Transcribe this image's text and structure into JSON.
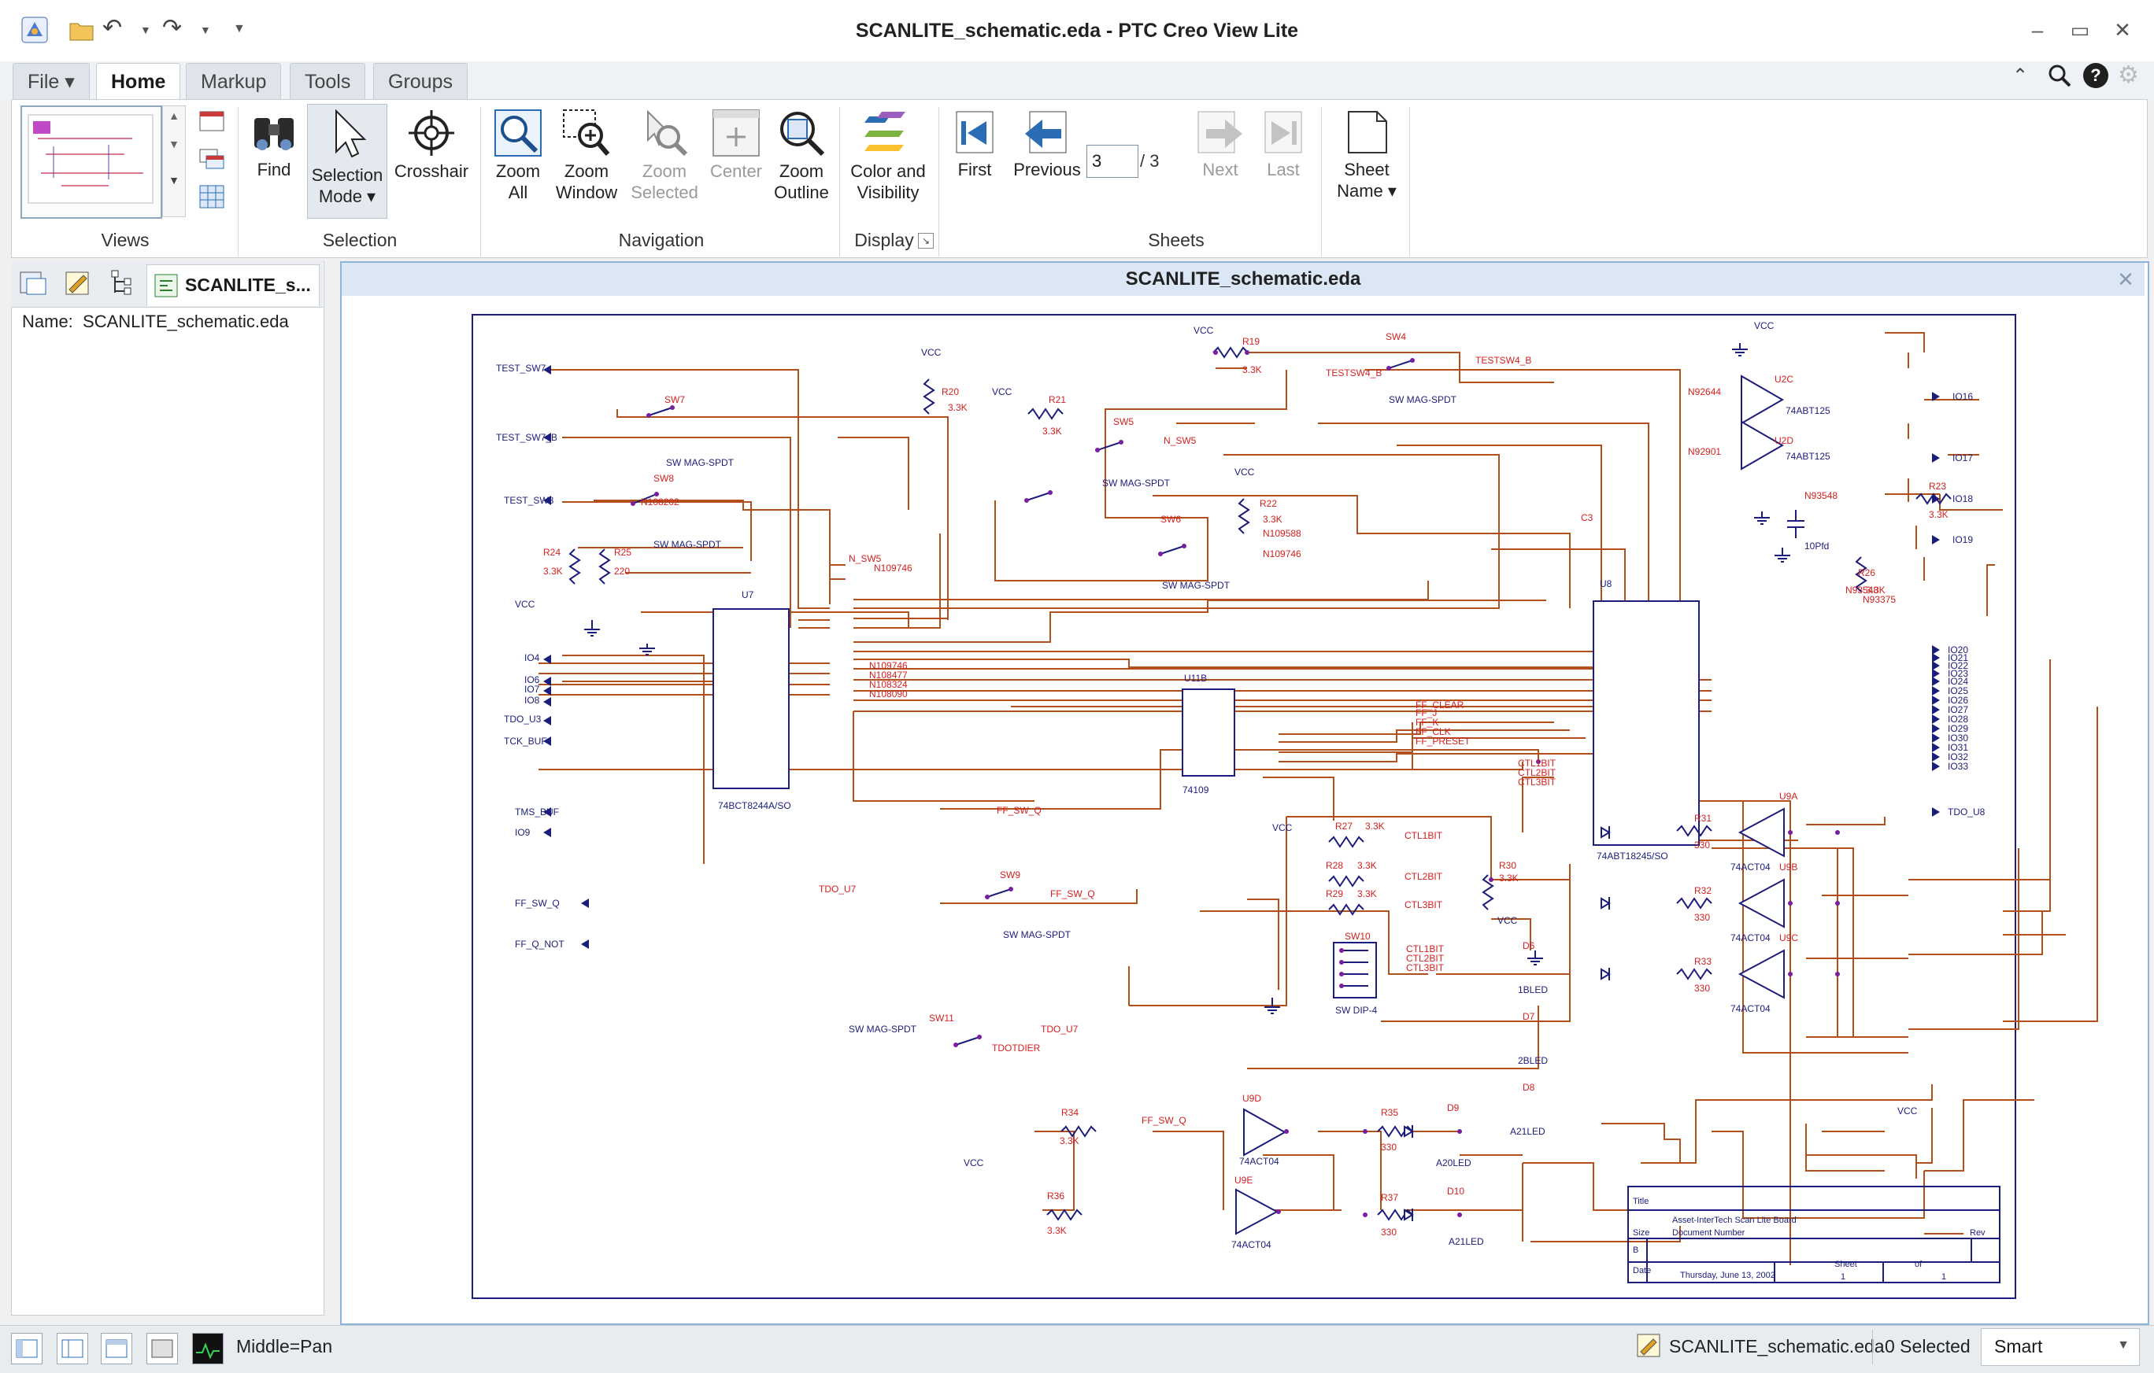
{
  "window": {
    "title": "SCANLITE_schematic.eda - PTC Creo View Lite"
  },
  "tabs": [
    "File",
    "Home",
    "Markup",
    "Tools",
    "Groups"
  ],
  "ribbon": {
    "views": {
      "label": "Views"
    },
    "selection": {
      "label": "Selection",
      "find": "Find",
      "selection_mode": [
        "Selection",
        "Mode"
      ],
      "crosshair": "Crosshair"
    },
    "navigation": {
      "label": "Navigation",
      "zoom_all": [
        "Zoom",
        "All"
      ],
      "zoom_window": [
        "Zoom",
        "Window"
      ],
      "zoom_selected": [
        "Zoom",
        "Selected"
      ],
      "center": "Center",
      "zoom_outline": [
        "Zoom",
        "Outline"
      ]
    },
    "display": {
      "label": "Display",
      "color_visibility": [
        "Color and",
        "Visibility"
      ]
    },
    "sheets": {
      "label": "Sheets",
      "first": "First",
      "previous": "Previous",
      "page_value": "3",
      "page_total": "/ 3",
      "next": "Next",
      "last": "Last",
      "sheet_name": [
        "Sheet",
        "Name"
      ]
    }
  },
  "left_panel": {
    "tab_label": "SCANLITE_s...",
    "name_label": "Name:",
    "name_value": "SCANLITE_schematic.eda"
  },
  "viewer": {
    "title": "SCANLITE_schematic.eda",
    "schematic": {
      "title_block": {
        "title_label": "Title",
        "title_value": "Asset-InterTech Scan Lite Board",
        "doc_number_label": "Document Number",
        "rev_label": "Rev",
        "size_label": "Size",
        "size_value": "B",
        "date_label": "Date",
        "date_value": "Thursday, June 13, 2002",
        "sheet_label": "Sheet",
        "sheet_value": "1",
        "of_label": "of",
        "of_value": "1"
      },
      "components": [
        {
          "ref": "U7",
          "type": "74BCT8244A/SO"
        },
        {
          "ref": "U8",
          "type": "74ABT18245/SO"
        },
        {
          "ref": "U11B",
          "type": "74109"
        },
        {
          "ref": "U2C",
          "type": "74ABT125"
        },
        {
          "ref": "U2D",
          "type": "74ABT125"
        },
        {
          "ref": "U9A",
          "type": "74ACT04"
        },
        {
          "ref": "U9B",
          "type": "74ACT04"
        },
        {
          "ref": "U9C",
          "type": "74ACT04"
        },
        {
          "ref": "U9D",
          "type": "74ACT04"
        },
        {
          "ref": "U9E",
          "type": "74ACT04"
        },
        {
          "ref": "SW4",
          "type": "SW MAG-SPDT"
        },
        {
          "ref": "SW5",
          "type": "SW MAG-SPDT"
        },
        {
          "ref": "SW6",
          "type": "SW MAG-SPDT"
        },
        {
          "ref": "SW7",
          "type": "SW MAG-SPDT"
        },
        {
          "ref": "SW8",
          "type": "SW MAG-SPDT"
        },
        {
          "ref": "SW9",
          "type": "SW MAG-SPDT"
        },
        {
          "ref": "SW10",
          "type": "SW DIP-4"
        },
        {
          "ref": "SW11",
          "type": "SW MAG-SPDT"
        },
        {
          "ref": "D6",
          "type": "1BLED"
        },
        {
          "ref": "D7",
          "type": "2BLED"
        },
        {
          "ref": "D8",
          "type": "A21LED"
        },
        {
          "ref": "D9",
          "type": "A20LED"
        },
        {
          "ref": "D10",
          "type": "A21LED"
        },
        {
          "ref": "C3",
          "type": "10Pfd"
        }
      ],
      "resistors": [
        {
          "ref": "R19",
          "value": "3.3K"
        },
        {
          "ref": "R20",
          "value": "3.3K"
        },
        {
          "ref": "R21",
          "value": "3.3K"
        },
        {
          "ref": "R22",
          "value": "3.3K"
        },
        {
          "ref": "R23",
          "value": "3.3K"
        },
        {
          "ref": "R24",
          "value": "3.3K"
        },
        {
          "ref": "R25",
          "value": "220"
        },
        {
          "ref": "R26",
          "value": "3.3K"
        },
        {
          "ref": "R27",
          "value": "3.3K"
        },
        {
          "ref": "R28",
          "value": "3.3K"
        },
        {
          "ref": "R29",
          "value": "3.3K"
        },
        {
          "ref": "R30",
          "value": "3.3K"
        },
        {
          "ref": "R31",
          "value": "330"
        },
        {
          "ref": "R32",
          "value": "330"
        },
        {
          "ref": "R33",
          "value": "330"
        },
        {
          "ref": "R34",
          "value": "3.3K"
        },
        {
          "ref": "R35",
          "value": "330"
        },
        {
          "ref": "R36",
          "value": "3.3K"
        },
        {
          "ref": "R37",
          "value": "330"
        }
      ],
      "ports_left": [
        "TEST_SW7",
        "TEST_SW7_B",
        "TEST_SW8",
        "VCC",
        "IO4",
        "IO6",
        "IO7",
        "IO8",
        "TDO_U3",
        "TCK_BUF",
        "TMS_BUF",
        "IO9",
        "FF_SW_Q",
        "FF_Q_NOT"
      ],
      "ports_right": [
        "IO16",
        "IO17",
        "IO18",
        "IO19",
        "IO20",
        "IO21",
        "IO22",
        "IO23",
        "IO24",
        "IO25",
        "IO26",
        "IO27",
        "IO28",
        "IO29",
        "IO30",
        "IO31",
        "IO32",
        "IO33",
        "TDO_U8"
      ],
      "nets": [
        "N_SW5",
        "N109746",
        "N108477",
        "N108324",
        "N108090",
        "N109588",
        "N92644",
        "N92901",
        "N93548",
        "N93375",
        "FF_CLEAR",
        "FF_J",
        "FF_K",
        "FF_CLK",
        "FF_PRESET",
        "CTL1BIT",
        "CTL2BIT",
        "CTL3BIT",
        "FF_SW_Q",
        "TDO_U7",
        "TDOTDIER",
        "TESTSW4_B",
        "VCC"
      ]
    }
  },
  "status": {
    "mouse_hint": "Middle=Pan",
    "file": "SCANLITE_schematic.eda",
    "selected": "0 Selected",
    "mode": "Smart"
  },
  "icons": [
    "app-icon",
    "open-icon",
    "undo-icon",
    "redo-icon",
    "customize-icon",
    "minimize-icon",
    "maximize-icon",
    "close-icon",
    "collapse-ribbon-icon",
    "search-icon",
    "help-icon",
    "settings-icon",
    "binoculars-icon",
    "cursor-icon",
    "crosshair-icon",
    "zoom-icon",
    "first-icon",
    "previous-icon",
    "next-icon",
    "last-icon",
    "sheet-icon"
  ],
  "colors": {
    "wire": "#b2501c",
    "symbol": "#1b1d7a",
    "label": "#d42020",
    "pin": "#7b1fa2",
    "accent": "#2a6db5"
  }
}
